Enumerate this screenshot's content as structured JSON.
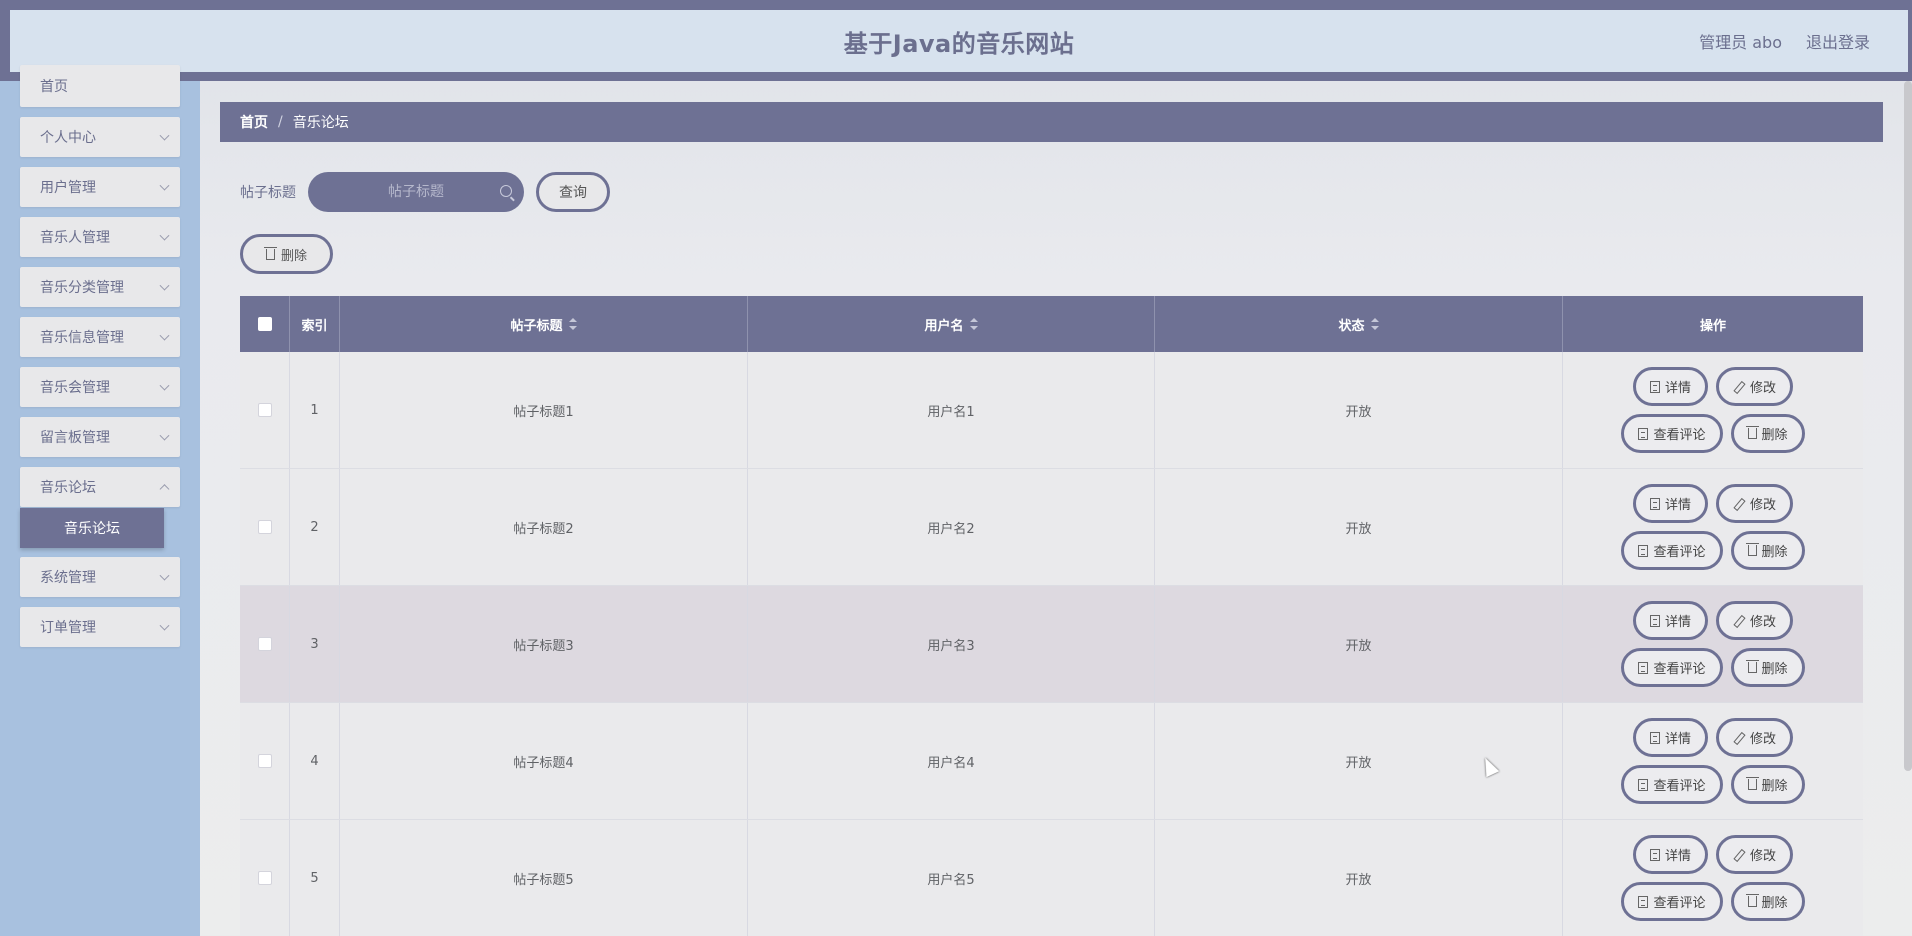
{
  "header": {
    "title": "基于Java的音乐网站",
    "user_label": "管理员 abo",
    "logout_label": "退出登录"
  },
  "sidebar": {
    "items": [
      {
        "label": "首页"
      },
      {
        "label": "个人中心"
      },
      {
        "label": "用户管理"
      },
      {
        "label": "音乐人管理"
      },
      {
        "label": "音乐分类管理"
      },
      {
        "label": "音乐信息管理"
      },
      {
        "label": "音乐会管理"
      },
      {
        "label": "留言板管理"
      },
      {
        "label": "音乐论坛"
      },
      {
        "label": "系统管理"
      },
      {
        "label": "订单管理"
      }
    ],
    "active_sub": "音乐论坛"
  },
  "breadcrumb": {
    "home": "首页",
    "separator": "/",
    "current": "音乐论坛"
  },
  "search": {
    "label": "帖子标题",
    "placeholder": "帖子标题",
    "query_label": "查询"
  },
  "toolbar": {
    "delete_label": "删除"
  },
  "table": {
    "columns": {
      "index": "索引",
      "title": "帖子标题",
      "user": "用户名",
      "status": "状态",
      "op": "操作"
    },
    "rows": [
      {
        "index": "1",
        "title": "帖子标题1",
        "user": "用户名1",
        "status": "开放"
      },
      {
        "index": "2",
        "title": "帖子标题2",
        "user": "用户名2",
        "status": "开放"
      },
      {
        "index": "3",
        "title": "帖子标题3",
        "user": "用户名3",
        "status": "开放"
      },
      {
        "index": "4",
        "title": "帖子标题4",
        "user": "用户名4",
        "status": "开放"
      },
      {
        "index": "5",
        "title": "帖子标题5",
        "user": "用户名5",
        "status": "开放"
      }
    ],
    "actions": {
      "detail": "详情",
      "edit": "修改",
      "comments": "查看评论",
      "delete": "删除"
    }
  },
  "colors": {
    "accent": "#6e7194",
    "header_bg": "#d7e2ee",
    "sidebar_bg": "#a8c1df"
  }
}
